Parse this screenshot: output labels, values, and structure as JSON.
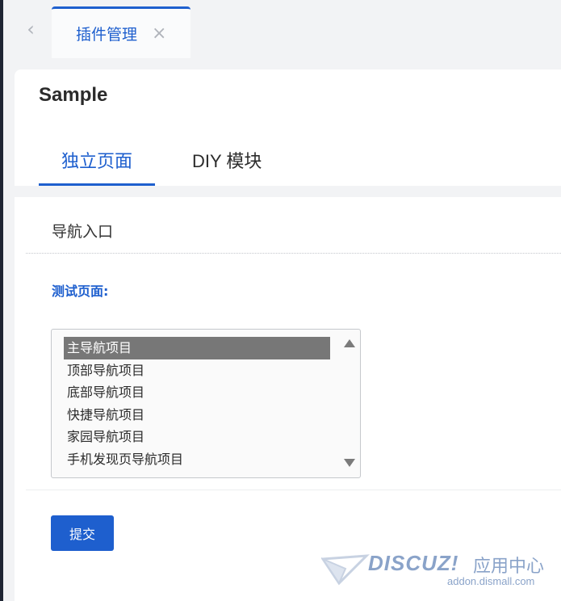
{
  "tabbar": {
    "back_glyph": "‹",
    "active_tab": {
      "label": "插件管理",
      "close_glyph": "×"
    }
  },
  "plugin": {
    "title": "Sample",
    "tabs": [
      {
        "label": "独立页面",
        "active": true
      },
      {
        "label": "DIY 模块",
        "active": false
      }
    ]
  },
  "section": {
    "title": "导航入口",
    "field_label": "测试页面:",
    "options": [
      {
        "label": "主导航项目",
        "selected": true
      },
      {
        "label": "顶部导航项目",
        "selected": false
      },
      {
        "label": "底部导航项目",
        "selected": false
      },
      {
        "label": "快捷导航项目",
        "selected": false
      },
      {
        "label": "家园导航项目",
        "selected": false
      },
      {
        "label": "手机发现页导航项目",
        "selected": false
      }
    ],
    "submit_label": "提交"
  },
  "watermark": {
    "brand": "DISCUZ!",
    "suffix": "应用中心",
    "url": "addon.dismall.com"
  },
  "colors": {
    "accent": "#1e5fce",
    "selected_bg": "#777777",
    "watermark": "#8aa3c9"
  }
}
